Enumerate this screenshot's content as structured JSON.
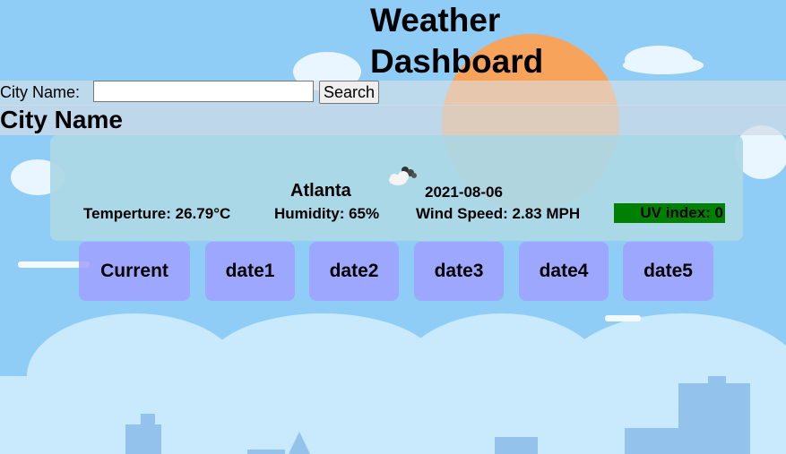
{
  "header": {
    "title": "Weather Dashboard"
  },
  "search": {
    "label": "City Name:",
    "input_value": "",
    "button_label": "Search"
  },
  "city_heading": "City Name",
  "current": {
    "icon": "cloudy-icon",
    "city": "Atlanta",
    "date": "2021-08-06",
    "temperature": "Temperture: 26.79°C",
    "humidity": "Humidity: 65%",
    "wind_speed": "Wind Speed: 2.83 MPH",
    "uv_index": "UV index: 0",
    "uv_color": "#008000"
  },
  "tabs": [
    {
      "label": "Current"
    },
    {
      "label": "date1"
    },
    {
      "label": "date2"
    },
    {
      "label": "date3"
    },
    {
      "label": "date4"
    },
    {
      "label": "date5"
    }
  ],
  "colors": {
    "sky": "#8fcdf6",
    "sun": "#f7a35c",
    "card": "#add8e6",
    "tab": "#a0a0ff"
  }
}
